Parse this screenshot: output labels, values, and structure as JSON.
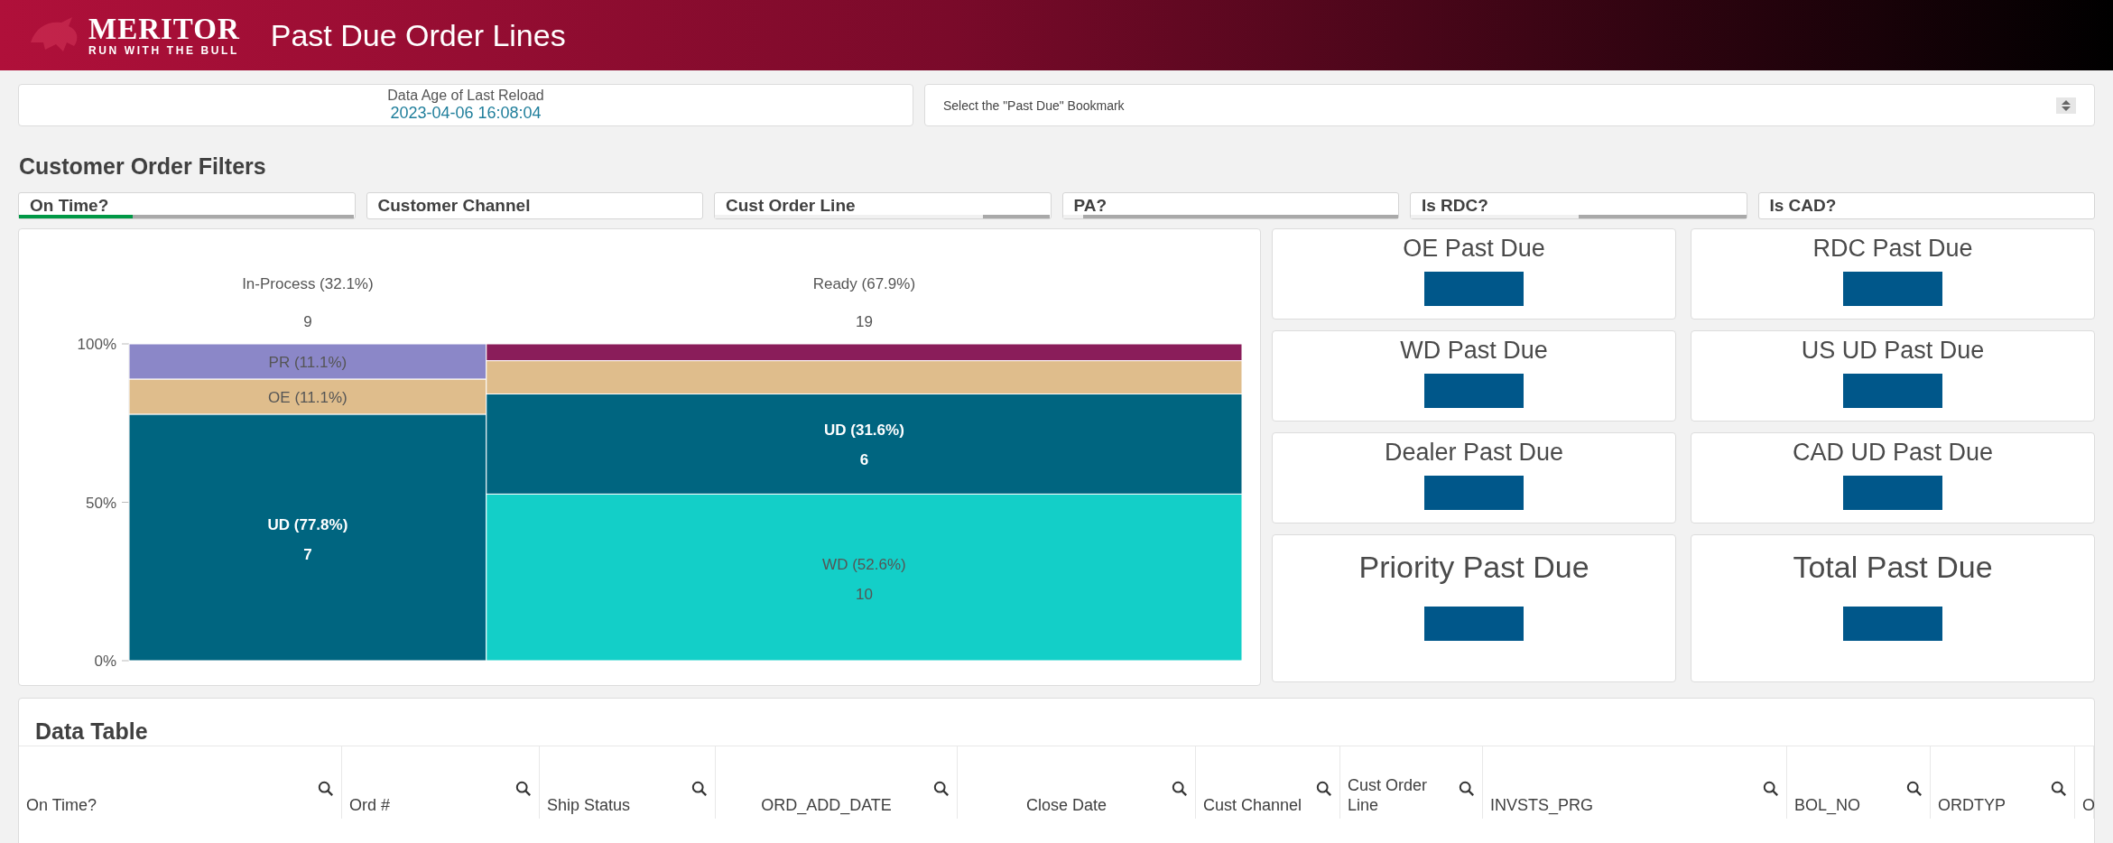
{
  "header": {
    "logo_name": "MERITOR",
    "logo_tagline": "RUN WITH THE BULL",
    "title": "Past Due Order Lines"
  },
  "data_age": {
    "label": "Data Age of Last Reload",
    "value": "2023-04-06 16:08:04"
  },
  "bookmark_select": {
    "value": "Select the \"Past Due\" Bookmark"
  },
  "filters_title": "Customer Order Filters",
  "filters": [
    {
      "label": "On Time?",
      "segments": [
        {
          "kind": "selected",
          "level": 0.34
        },
        {
          "kind": "excluded",
          "level": 0.66
        }
      ]
    },
    {
      "label": "Customer Channel"
    },
    {
      "label": "Cust Order Line",
      "segments": [
        {
          "kind": "none",
          "level": 0.8
        },
        {
          "kind": "excluded",
          "level": 0.2
        }
      ]
    },
    {
      "label": "PA?",
      "segments": [
        {
          "kind": "none",
          "level": 0.06
        },
        {
          "kind": "excluded",
          "level": 0.94
        }
      ]
    },
    {
      "label": "Is RDC?",
      "segments": [
        {
          "kind": "none",
          "level": 0.5
        },
        {
          "kind": "excluded",
          "level": 0.5
        }
      ]
    },
    {
      "label": "Is CAD?"
    }
  ],
  "chart": {
    "chart_data": {
      "type": "bar",
      "stacked": true,
      "categories": [
        "In-Process (32.1%)",
        "Ready (67.9%)"
      ],
      "ylim": [
        0,
        100
      ],
      "yticks": [
        {
          "value": 0,
          "label": "0%"
        },
        {
          "value": 50,
          "label": "50%"
        },
        {
          "value": 100,
          "label": "100%"
        }
      ],
      "series": [
        {
          "color": "#13cfc8",
          "values": [
            null,
            52.6
          ]
        },
        {
          "color": "#006580",
          "values": [
            77.8,
            31.6
          ]
        },
        {
          "color": "#dfbd8c",
          "values": [
            11.1,
            10.5
          ]
        },
        {
          "color": "#8b87c8",
          "values": [
            11.1,
            null
          ]
        },
        {
          "color": "#8a1d5a",
          "values": [
            null,
            5.3
          ]
        }
      ],
      "annotations": [
        "9",
        "19",
        "PR (11.1%)",
        "OE (11.1%)",
        "UD (77.8%)",
        "7",
        "UD (31.6%)",
        "6",
        "WD (52.6%)",
        "10"
      ]
    }
  },
  "kpis": [
    {
      "title": "OE Past Due",
      "kind": "small"
    },
    {
      "title": "RDC Past Due",
      "kind": "small"
    },
    {
      "title": "WD Past Due",
      "kind": "small"
    },
    {
      "title": "US UD Past Due",
      "kind": "small"
    },
    {
      "title": "Dealer Past Due",
      "kind": "small"
    },
    {
      "title": "CAD UD Past Due",
      "kind": "small"
    },
    {
      "title": "Priority Past Due",
      "kind": "large"
    },
    {
      "title": "Total Past Due",
      "kind": "large"
    }
  ],
  "data_table": {
    "title": "Data Table",
    "columns": [
      "On Time?",
      "Ord #",
      "Ship Status",
      "ORD_ADD_DATE",
      "Close Date",
      "Cust Channel",
      "Cust Order Line",
      "INVSTS_PRG",
      "BOL_NO",
      "ORDTYP",
      "O"
    ]
  }
}
